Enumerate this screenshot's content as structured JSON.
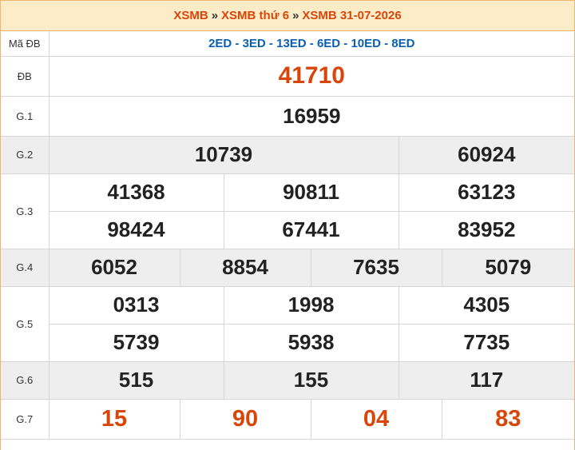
{
  "header": {
    "crumb1": "XSMB",
    "crumb2": "XSMB thứ 6",
    "crumb3": "XSMB 31-07-2026",
    "separator": "»"
  },
  "table": {
    "madb": {
      "label": "Mã ĐB",
      "value": "2ED - 3ED - 13ED - 6ED - 10ED - 8ED"
    },
    "db": {
      "label": "ĐB",
      "numbers": [
        "41710"
      ]
    },
    "g1": {
      "label": "G.1",
      "numbers": [
        "16959"
      ]
    },
    "g2": {
      "label": "G.2",
      "numbers": [
        "10739",
        "60924"
      ]
    },
    "g3": {
      "label": "G.3",
      "numbers": [
        "41368",
        "90811",
        "63123",
        "98424",
        "67441",
        "83952"
      ]
    },
    "g4": {
      "label": "G.4",
      "numbers": [
        "6052",
        "8854",
        "7635",
        "5079"
      ]
    },
    "g5": {
      "label": "G.5",
      "numbers": [
        "0313",
        "1998",
        "4305",
        "5739",
        "5938",
        "7735"
      ]
    },
    "g6": {
      "label": "G.6",
      "numbers": [
        "515",
        "155",
        "117"
      ]
    },
    "g7": {
      "label": "G.7",
      "numbers": [
        "15",
        "90",
        "04",
        "83"
      ]
    }
  },
  "colors": {
    "accent": "#d9460a",
    "code_blue": "#0b5fb0",
    "header_bg": "#fcecc8",
    "border": "#f0b46c"
  }
}
